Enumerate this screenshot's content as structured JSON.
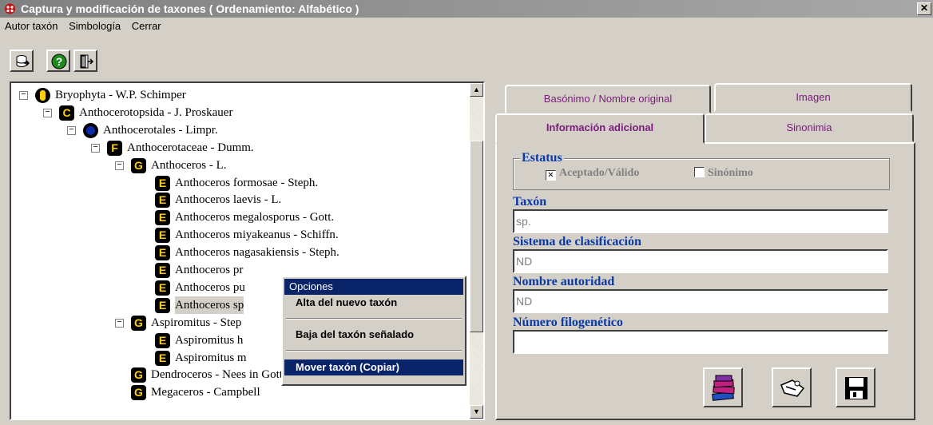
{
  "window": {
    "title": "Captura y modificación de taxones  ( Ordenamiento: Alfabético )",
    "close_glyph": "✕"
  },
  "menu": [
    "Autor taxón",
    "Simbología",
    "Cerrar"
  ],
  "toolbar": {
    "buttons": [
      "database-export-icon",
      "help-icon",
      "exit-door-icon"
    ],
    "help_glyph": "?"
  },
  "tree": {
    "items": [
      {
        "badge": "D",
        "label": "Bryophyta - W.P. Schimper",
        "toggle": "−"
      },
      {
        "badge": "C",
        "label": "Anthocerotopsida - J. Proskauer",
        "toggle": "−"
      },
      {
        "badge": "O",
        "label": "Anthocerotales - Limpr.",
        "toggle": "−"
      },
      {
        "badge": "F",
        "label": "Anthocerotaceae - Dumm.",
        "toggle": "−"
      },
      {
        "badge": "G",
        "label": "Anthoceros - L.",
        "toggle": "−"
      },
      {
        "badge": "E",
        "label": "Anthoceros formosae - Steph."
      },
      {
        "badge": "E",
        "label": "Anthoceros laevis - L."
      },
      {
        "badge": "E",
        "label": "Anthoceros megalosporus - Gott."
      },
      {
        "badge": "E",
        "label": "Anthoceros miyakeanus - Schiffn."
      },
      {
        "badge": "E",
        "label": "Anthoceros nagasakiensis - Steph."
      },
      {
        "badge": "E",
        "label": "Anthoceros pr"
      },
      {
        "badge": "E",
        "label": "Anthoceros pu"
      },
      {
        "badge": "E",
        "label": "Anthoceros sp"
      },
      {
        "badge": "G",
        "label": "Aspiromitus - Step",
        "toggle": "−"
      },
      {
        "badge": "E",
        "label": "Aspiromitus h"
      },
      {
        "badge": "E",
        "label": "Aspiromitus m"
      },
      {
        "badge": "G",
        "label": "Dendroceros - Nees in Gott."
      },
      {
        "badge": "G",
        "label": "Megaceros - Campbell"
      }
    ],
    "scroll_up": "▲",
    "scroll_down": "▼"
  },
  "context_menu": {
    "title": "Opciones",
    "items": [
      "Alta del nuevo taxón",
      "Baja del taxón señalado",
      "Mover taxón (Copiar)"
    ]
  },
  "tabs": {
    "back_row": [
      "Basónimo / Nombre original",
      "Imagen"
    ],
    "front_row": [
      "Información adicional",
      "Sinonimia"
    ]
  },
  "form": {
    "estatus_title": "Estatus",
    "aceptado_label": "Aceptado/Válido",
    "aceptado_mark": "✕",
    "sinonimo_label": "Sinónimo",
    "taxon_label": "Taxón",
    "taxon_value": "sp.",
    "sistema_label": "Sistema de clasificación",
    "sistema_value": "ND",
    "autoridad_label": "Nombre autoridad",
    "autoridad_value": "ND",
    "filogenetico_label": "Número filogenético",
    "filogenetico_value": ""
  },
  "actions": [
    "books-icon",
    "hand-edit-icon",
    "save-disk-icon"
  ]
}
